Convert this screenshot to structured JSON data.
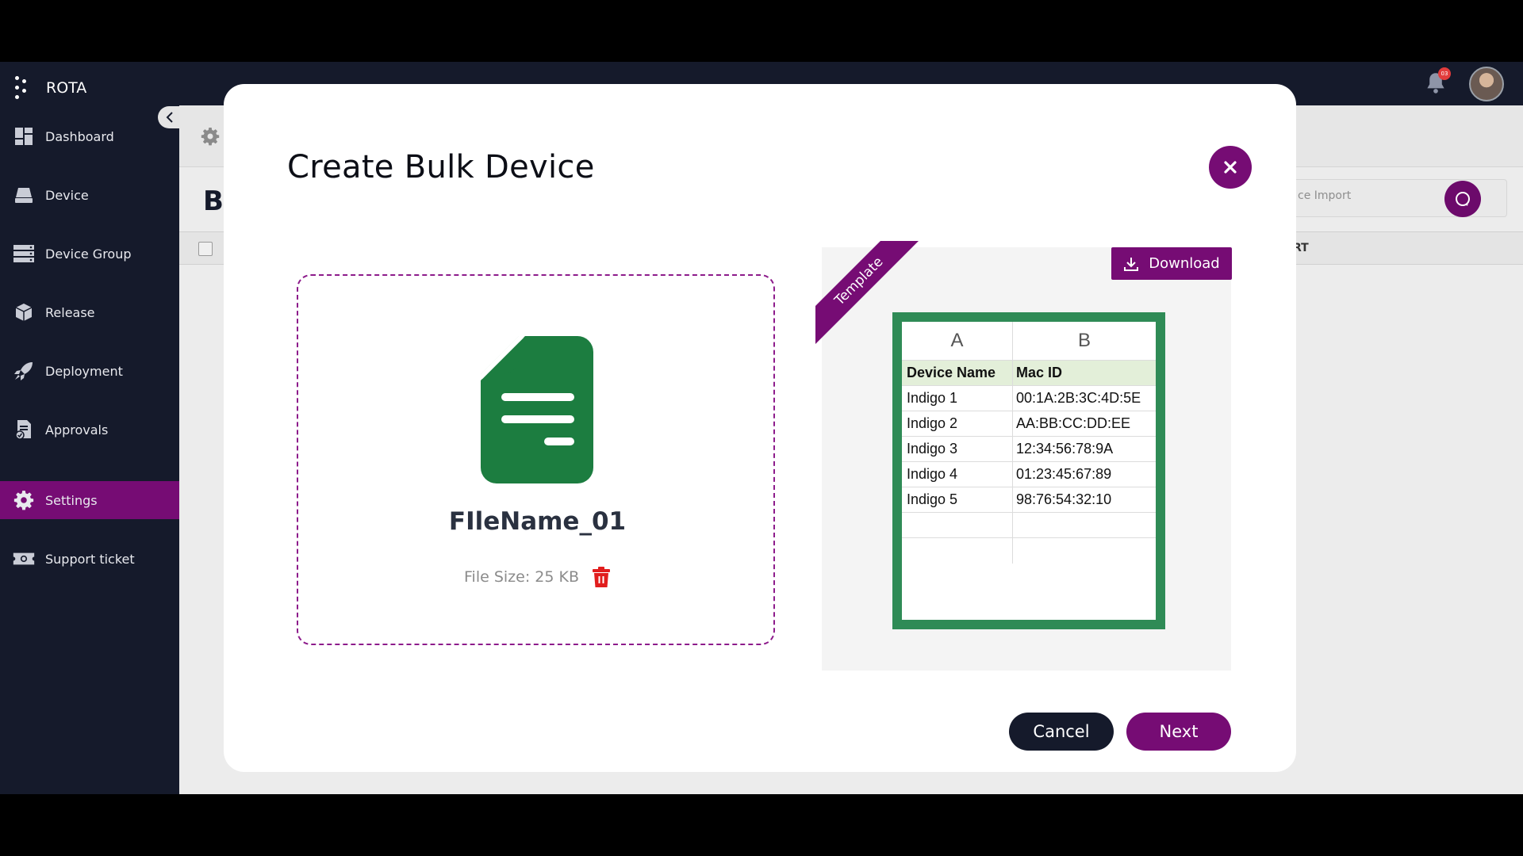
{
  "app": {
    "name": "ROTA"
  },
  "notifications": {
    "count": "03"
  },
  "sidebar": {
    "items": [
      {
        "label": "Dashboard",
        "icon": "dashboard-icon"
      },
      {
        "label": "Device",
        "icon": "device-icon"
      },
      {
        "label": "Device Group",
        "icon": "device-group-icon"
      },
      {
        "label": "Release",
        "icon": "release-box-icon"
      },
      {
        "label": "Deployment",
        "icon": "rocket-icon"
      },
      {
        "label": "Approvals",
        "icon": "approvals-icon"
      },
      {
        "label": "Settings",
        "icon": "gear-icon",
        "active": true
      },
      {
        "label": "Support ticket",
        "icon": "ticket-icon"
      }
    ]
  },
  "background": {
    "page_title": "B",
    "search_placeholder": "ce Import",
    "column_header": "RT"
  },
  "modal": {
    "title": "Create Bulk Device",
    "file": {
      "name": "FIleName_01",
      "size": "File Size: 25 KB"
    },
    "template": {
      "ribbon": "Template",
      "download_label": "Download",
      "sheet": {
        "col_letters": [
          "A",
          "B"
        ],
        "headers": [
          "Device Name",
          "Mac ID"
        ],
        "rows": [
          [
            "Indigo 1",
            "00:1A:2B:3C:4D:5E"
          ],
          [
            "Indigo 2",
            "AA:BB:CC:DD:EE"
          ],
          [
            "Indigo 3",
            "12:34:56:78:9A"
          ],
          [
            "Indigo 4",
            "01:23:45:67:89"
          ],
          [
            "Indigo 5",
            "98:76:54:32:10"
          ],
          [
            "",
            ""
          ],
          [
            "",
            ""
          ]
        ]
      }
    },
    "cancel_label": "Cancel",
    "next_label": "Next"
  },
  "colors": {
    "primary": "#760c74",
    "dark": "#151a2b",
    "sheet_border": "#2f8b56",
    "file_icon": "#1c7d40",
    "delete": "#e11d1d"
  }
}
